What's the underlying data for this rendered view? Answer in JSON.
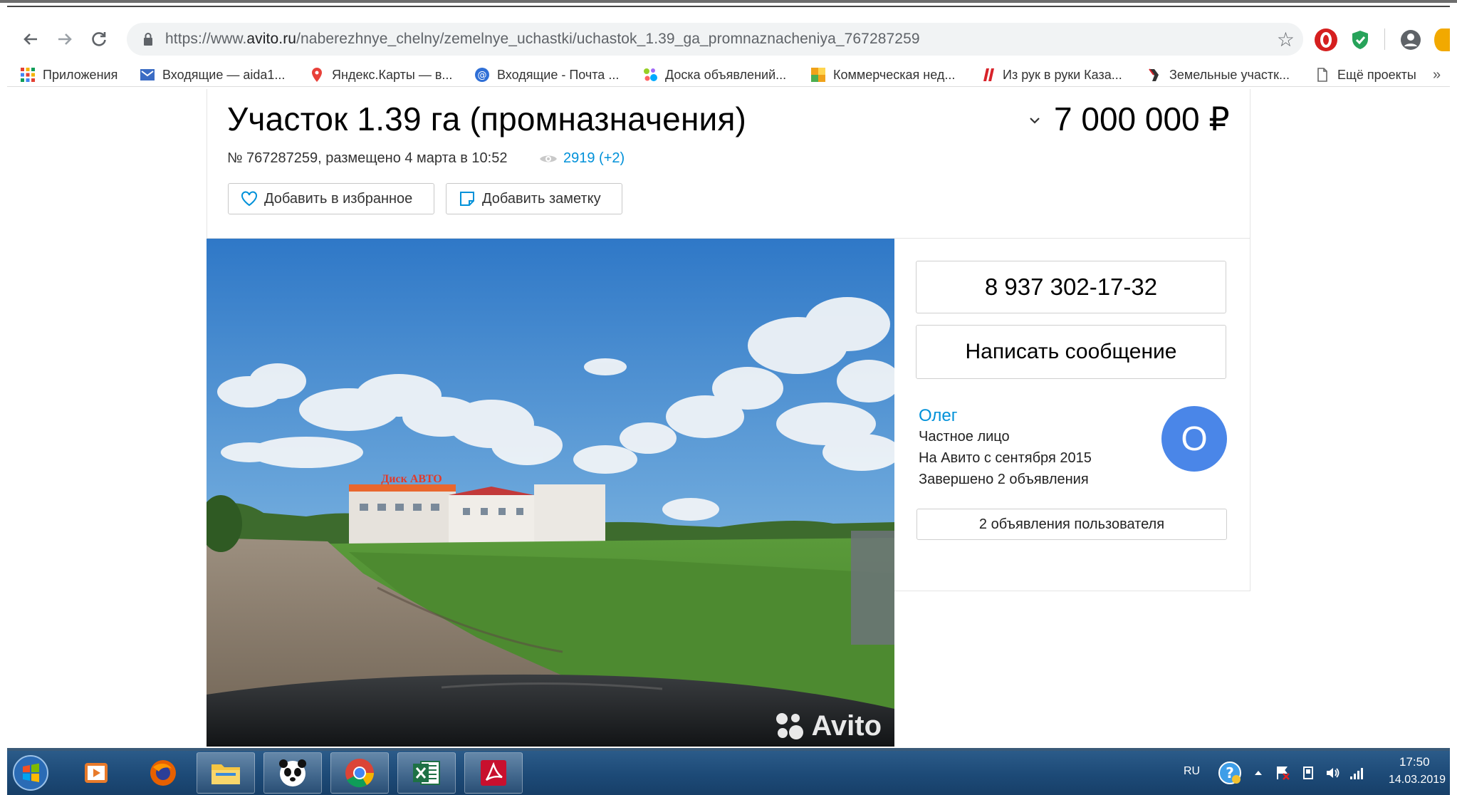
{
  "browser": {
    "url_prefix": "https://www.",
    "url_domain": "avito.ru",
    "url_path": "/naberezhnye_chelny/zemelnye_uchastki/uchastok_1.39_ga_promnaznacheniya_767287259"
  },
  "bookmarks": [
    {
      "label": "Приложения",
      "icon": "apps-grid-icon",
      "color": "#e34133"
    },
    {
      "label": "Входящие — aida1...",
      "icon": "mail-icon",
      "color": "#3b6cc4"
    },
    {
      "label": "Яндекс.Карты — в...",
      "icon": "map-pin-icon",
      "color": "#e8413a"
    },
    {
      "label": "Входящие - Почта ...",
      "icon": "mail-at-icon",
      "color": "#2f6fd6"
    },
    {
      "label": "Доска объявлений...",
      "icon": "avito-dots-icon",
      "color": "#97cf26"
    },
    {
      "label": "Коммерческая нед...",
      "icon": "commercial-icon",
      "color": "#f0a21a"
    },
    {
      "label": "Из рук в руки Каза...",
      "icon": "irr-icon",
      "color": "#d8232a"
    },
    {
      "label": "Земельные участк...",
      "icon": "land-icon",
      "color": "#333333"
    },
    {
      "label": "Ещё проекты",
      "icon": "document-icon",
      "color": "#777777"
    }
  ],
  "listing": {
    "title": "Участок 1.39 га (промназначения)",
    "price": "7 000 000 ₽",
    "meta": "№ 767287259, размещено 4 марта в 10:52",
    "views": "2919 (+2)",
    "favorite_label": "Добавить в избранное",
    "note_label": "Добавить заметку",
    "watermark": "Avito",
    "photo_sign": "Диск АВТО"
  },
  "contact": {
    "phone": "8 937 302-17-32",
    "message_label": "Написать сообщение",
    "seller_name": "Олег",
    "seller_type": "Частное лицо",
    "seller_since": "На Авито с сентября 2015",
    "seller_completed": "Завершено 2 объявления",
    "avatar_letter": "О",
    "more_ads_label": "2 объявления пользователя"
  },
  "taskbar": {
    "language": "RU",
    "time": "17:50",
    "date": "14.03.2019"
  },
  "colors": {
    "link": "#0091d9",
    "avatar": "#4a86e8",
    "taskbar": "#1d4a77"
  }
}
